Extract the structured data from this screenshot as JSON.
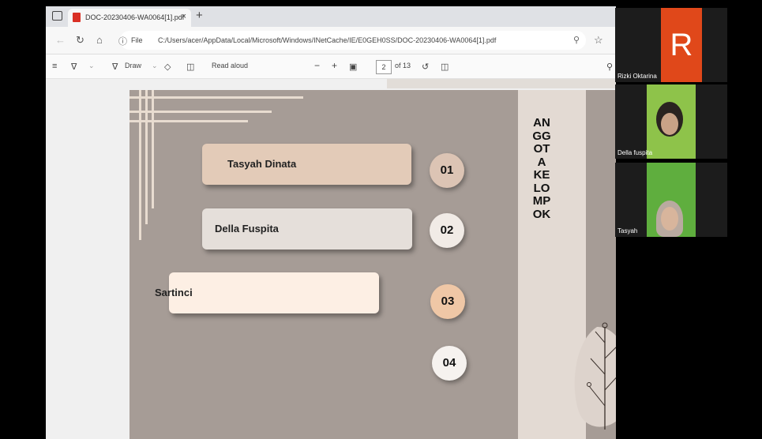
{
  "browser": {
    "tab_title": "DOC-20230406-WA0064[1].pdf",
    "tab_close": "×",
    "new_tab": "+",
    "address_label": "File",
    "url": "C:/Users/acer/AppData/Local/Microsoft/Windows/INetCache/IE/E0GEH0SS/DOC-20230406-WA0064[1].pdf"
  },
  "pdf_toolbar": {
    "draw_label": "Draw",
    "read_aloud_label": "Read aloud",
    "zoom_minus": "−",
    "zoom_plus": "+",
    "page_current": "2",
    "page_total": "of 13"
  },
  "slide": {
    "vertical_title": "ANGGOTA KELOMPOK",
    "members": [
      {
        "name": "Tasyah Dinata",
        "number": "01"
      },
      {
        "name": "Della Fuspita",
        "number": "02"
      },
      {
        "name": "Sartinci",
        "number": "03"
      },
      {
        "name": "",
        "number": "04"
      }
    ]
  },
  "participants": [
    {
      "name": "Rizki Oktarina",
      "avatar_letter": "R",
      "avatar_color": "#e0481a"
    },
    {
      "name": "Della fuspita"
    },
    {
      "name": "Tasyah"
    }
  ],
  "colors": {
    "card1": "#e3cbb8",
    "card2": "#e5dfda",
    "card3": "#fdefe4",
    "circle1": "#dcc4b4",
    "circle2": "#f1ebe6",
    "circle3": "#efc7a6",
    "circle4": "#f6f2ef"
  }
}
